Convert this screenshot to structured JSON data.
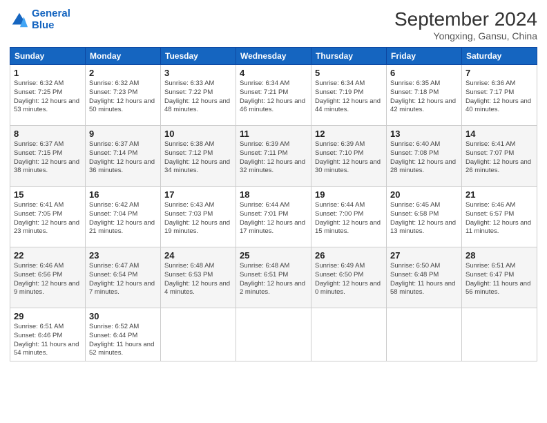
{
  "header": {
    "logo_line1": "General",
    "logo_line2": "Blue",
    "title": "September 2024",
    "subtitle": "Yongxing, Gansu, China"
  },
  "weekdays": [
    "Sunday",
    "Monday",
    "Tuesday",
    "Wednesday",
    "Thursday",
    "Friday",
    "Saturday"
  ],
  "weeks": [
    [
      {
        "day": "1",
        "sunrise": "6:32 AM",
        "sunset": "7:25 PM",
        "daylight": "12 hours and 53 minutes."
      },
      {
        "day": "2",
        "sunrise": "6:32 AM",
        "sunset": "7:23 PM",
        "daylight": "12 hours and 50 minutes."
      },
      {
        "day": "3",
        "sunrise": "6:33 AM",
        "sunset": "7:22 PM",
        "daylight": "12 hours and 48 minutes."
      },
      {
        "day": "4",
        "sunrise": "6:34 AM",
        "sunset": "7:21 PM",
        "daylight": "12 hours and 46 minutes."
      },
      {
        "day": "5",
        "sunrise": "6:34 AM",
        "sunset": "7:19 PM",
        "daylight": "12 hours and 44 minutes."
      },
      {
        "day": "6",
        "sunrise": "6:35 AM",
        "sunset": "7:18 PM",
        "daylight": "12 hours and 42 minutes."
      },
      {
        "day": "7",
        "sunrise": "6:36 AM",
        "sunset": "7:17 PM",
        "daylight": "12 hours and 40 minutes."
      }
    ],
    [
      {
        "day": "8",
        "sunrise": "6:37 AM",
        "sunset": "7:15 PM",
        "daylight": "12 hours and 38 minutes."
      },
      {
        "day": "9",
        "sunrise": "6:37 AM",
        "sunset": "7:14 PM",
        "daylight": "12 hours and 36 minutes."
      },
      {
        "day": "10",
        "sunrise": "6:38 AM",
        "sunset": "7:12 PM",
        "daylight": "12 hours and 34 minutes."
      },
      {
        "day": "11",
        "sunrise": "6:39 AM",
        "sunset": "7:11 PM",
        "daylight": "12 hours and 32 minutes."
      },
      {
        "day": "12",
        "sunrise": "6:39 AM",
        "sunset": "7:10 PM",
        "daylight": "12 hours and 30 minutes."
      },
      {
        "day": "13",
        "sunrise": "6:40 AM",
        "sunset": "7:08 PM",
        "daylight": "12 hours and 28 minutes."
      },
      {
        "day": "14",
        "sunrise": "6:41 AM",
        "sunset": "7:07 PM",
        "daylight": "12 hours and 26 minutes."
      }
    ],
    [
      {
        "day": "15",
        "sunrise": "6:41 AM",
        "sunset": "7:05 PM",
        "daylight": "12 hours and 23 minutes."
      },
      {
        "day": "16",
        "sunrise": "6:42 AM",
        "sunset": "7:04 PM",
        "daylight": "12 hours and 21 minutes."
      },
      {
        "day": "17",
        "sunrise": "6:43 AM",
        "sunset": "7:03 PM",
        "daylight": "12 hours and 19 minutes."
      },
      {
        "day": "18",
        "sunrise": "6:44 AM",
        "sunset": "7:01 PM",
        "daylight": "12 hours and 17 minutes."
      },
      {
        "day": "19",
        "sunrise": "6:44 AM",
        "sunset": "7:00 PM",
        "daylight": "12 hours and 15 minutes."
      },
      {
        "day": "20",
        "sunrise": "6:45 AM",
        "sunset": "6:58 PM",
        "daylight": "12 hours and 13 minutes."
      },
      {
        "day": "21",
        "sunrise": "6:46 AM",
        "sunset": "6:57 PM",
        "daylight": "12 hours and 11 minutes."
      }
    ],
    [
      {
        "day": "22",
        "sunrise": "6:46 AM",
        "sunset": "6:56 PM",
        "daylight": "12 hours and 9 minutes."
      },
      {
        "day": "23",
        "sunrise": "6:47 AM",
        "sunset": "6:54 PM",
        "daylight": "12 hours and 7 minutes."
      },
      {
        "day": "24",
        "sunrise": "6:48 AM",
        "sunset": "6:53 PM",
        "daylight": "12 hours and 4 minutes."
      },
      {
        "day": "25",
        "sunrise": "6:48 AM",
        "sunset": "6:51 PM",
        "daylight": "12 hours and 2 minutes."
      },
      {
        "day": "26",
        "sunrise": "6:49 AM",
        "sunset": "6:50 PM",
        "daylight": "12 hours and 0 minutes."
      },
      {
        "day": "27",
        "sunrise": "6:50 AM",
        "sunset": "6:48 PM",
        "daylight": "11 hours and 58 minutes."
      },
      {
        "day": "28",
        "sunrise": "6:51 AM",
        "sunset": "6:47 PM",
        "daylight": "11 hours and 56 minutes."
      }
    ],
    [
      {
        "day": "29",
        "sunrise": "6:51 AM",
        "sunset": "6:46 PM",
        "daylight": "11 hours and 54 minutes."
      },
      {
        "day": "30",
        "sunrise": "6:52 AM",
        "sunset": "6:44 PM",
        "daylight": "11 hours and 52 minutes."
      },
      null,
      null,
      null,
      null,
      null
    ]
  ]
}
